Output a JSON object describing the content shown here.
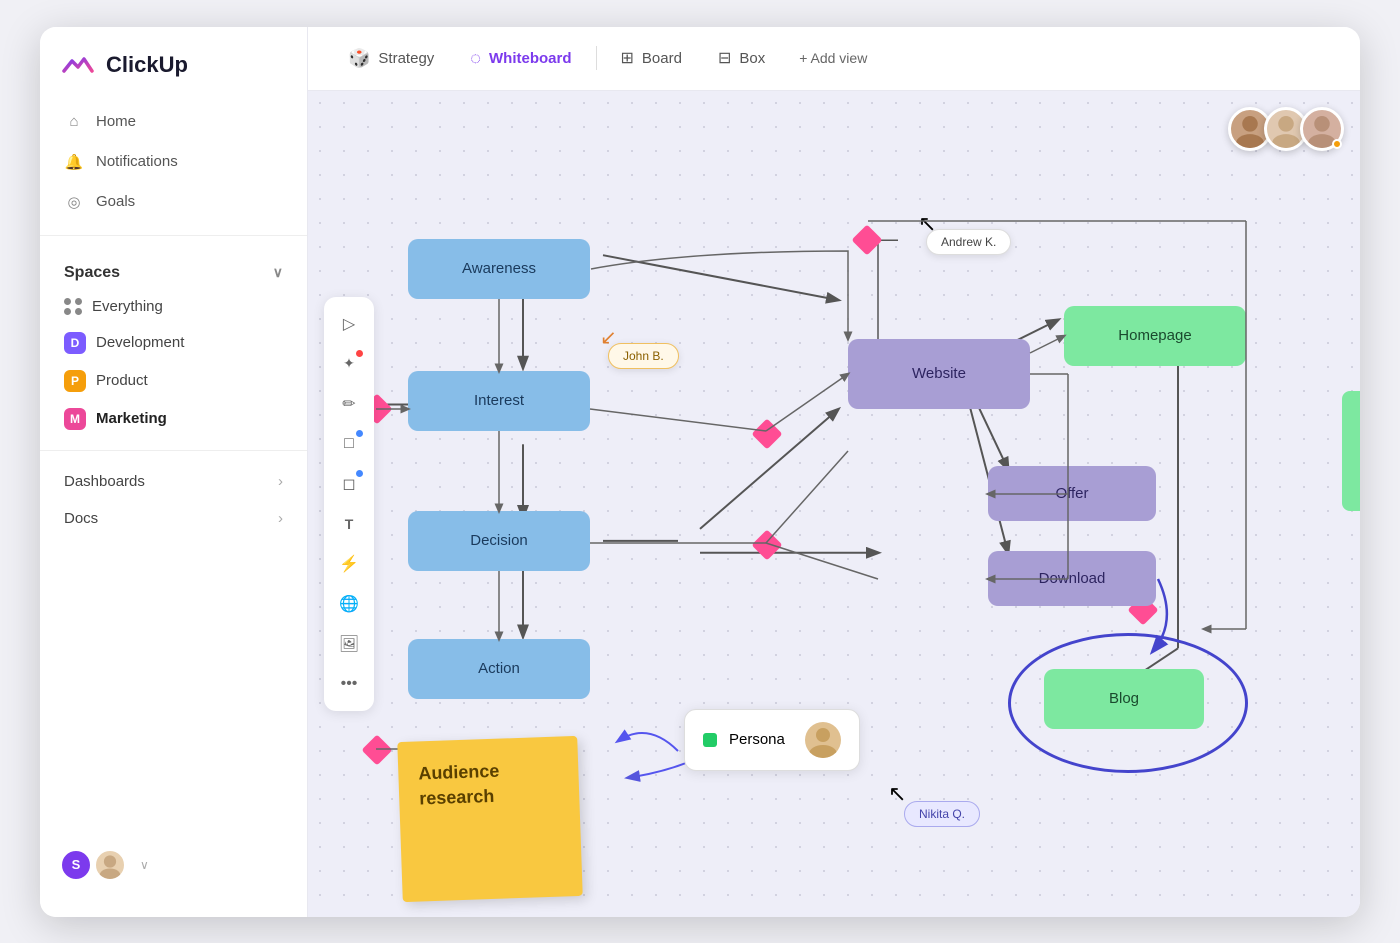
{
  "app": {
    "name": "ClickUp"
  },
  "sidebar": {
    "nav": [
      {
        "id": "home",
        "label": "Home",
        "icon": "🏠"
      },
      {
        "id": "notifications",
        "label": "Notifications",
        "icon": "🔔"
      },
      {
        "id": "goals",
        "label": "Goals",
        "icon": "🎯"
      }
    ],
    "spaces_label": "Spaces",
    "spaces": [
      {
        "id": "everything",
        "label": "Everything",
        "color": null
      },
      {
        "id": "development",
        "label": "Development",
        "color": "#7c5cff",
        "initial": "D"
      },
      {
        "id": "product",
        "label": "Product",
        "color": "#f59e0b",
        "initial": "P"
      },
      {
        "id": "marketing",
        "label": "Marketing",
        "color": "#ec4899",
        "initial": "M"
      }
    ],
    "dashboards_label": "Dashboards",
    "docs_label": "Docs"
  },
  "tabs": [
    {
      "id": "strategy",
      "label": "Strategy",
      "active": false
    },
    {
      "id": "whiteboard",
      "label": "Whiteboard",
      "active": true
    },
    {
      "id": "board",
      "label": "Board",
      "active": false
    },
    {
      "id": "box",
      "label": "Box",
      "active": false
    },
    {
      "id": "add_view",
      "label": "+ Add view",
      "active": false
    }
  ],
  "whiteboard": {
    "nodes": [
      {
        "id": "awareness",
        "label": "Awareness",
        "type": "blue"
      },
      {
        "id": "interest",
        "label": "Interest",
        "type": "blue"
      },
      {
        "id": "decision",
        "label": "Decision",
        "type": "blue"
      },
      {
        "id": "action",
        "label": "Action",
        "type": "blue"
      },
      {
        "id": "website",
        "label": "Website",
        "type": "purple"
      },
      {
        "id": "offer",
        "label": "Offer",
        "type": "purple"
      },
      {
        "id": "download",
        "label": "Download",
        "type": "purple"
      },
      {
        "id": "homepage",
        "label": "Homepage",
        "type": "green"
      },
      {
        "id": "blog",
        "label": "Blog",
        "type": "green"
      }
    ],
    "labels": [
      {
        "id": "andrew",
        "text": "Andrew K."
      },
      {
        "id": "john",
        "text": "John B."
      },
      {
        "id": "nikita",
        "text": "Nikita Q."
      }
    ],
    "sticky": {
      "text": "Audience\nresearch"
    },
    "persona": {
      "label": "Persona"
    }
  }
}
